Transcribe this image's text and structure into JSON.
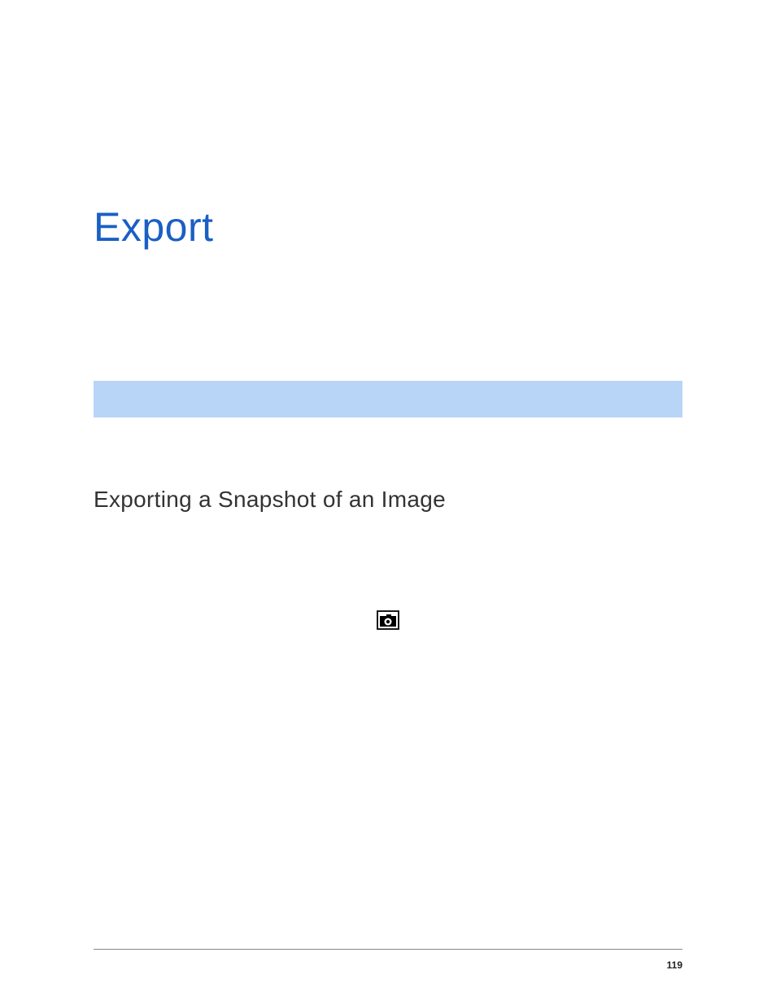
{
  "chapter": {
    "title": "Export"
  },
  "section": {
    "heading": "Exporting a Snapshot of an Image"
  },
  "icons": {
    "snapshot": "snapshot-icon"
  },
  "footer": {
    "page_number": "119"
  }
}
